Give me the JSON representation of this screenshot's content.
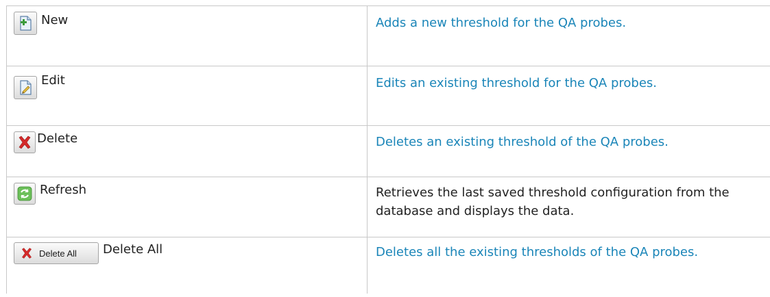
{
  "rows": [
    {
      "icon": "new-document-icon",
      "label": "New",
      "description": "Adds a new threshold for the QA probes.",
      "description_style": "link"
    },
    {
      "icon": "edit-document-icon",
      "label": "Edit",
      "description": "Edits an existing threshold for the QA probes.",
      "description_style": "link"
    },
    {
      "icon": "delete-icon",
      "label": "Delete",
      "description": "Deletes an existing threshold of the QA probes.",
      "description_style": "link"
    },
    {
      "icon": "refresh-icon",
      "label": "Refresh",
      "description": "Retrieves the last saved threshold configuration from the database and displays the data.",
      "description_style": "plain"
    },
    {
      "icon": "delete-all-icon",
      "label": "Delete All",
      "button_text": "Delete All",
      "description": "Deletes all the existing thresholds of the QA probes.",
      "description_style": "link"
    }
  ],
  "colors": {
    "link": "#1a85b8",
    "text": "#222222",
    "border": "#c8c8c8",
    "delete_red": "#d42a2a",
    "refresh_green": "#4aa53c",
    "new_green": "#3c9b3c"
  }
}
